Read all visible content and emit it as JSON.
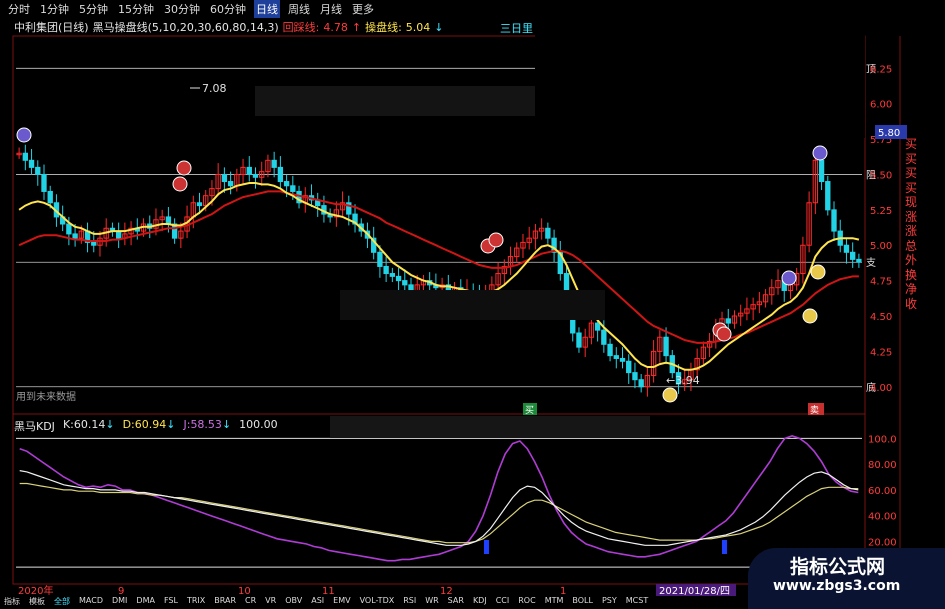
{
  "toolbar": {
    "timeframes": [
      "分时",
      "1分钟",
      "5分钟",
      "15分钟",
      "30分钟",
      "60分钟",
      "日线",
      "周线",
      "月线",
      "更多"
    ],
    "active": "日线"
  },
  "title": {
    "stock": "中利集团(日线)",
    "indicator": "黑马操盘线(5,10,20,30,60,80,14,3)",
    "line1_label": "回踩线:",
    "line1_value": "4.78",
    "line1_arrow": "↑",
    "line2_label": "操盘线:",
    "line2_value": "5.04",
    "line2_arrow": "↓",
    "right_label": "三日里"
  },
  "price_axis": {
    "ticks": [
      "6.25",
      "6.00",
      "5.75",
      "5.50",
      "5.25",
      "5.00",
      "4.75",
      "4.50",
      "4.25",
      "4.00"
    ],
    "current": "5.80"
  },
  "zone_labels": {
    "top": "顶",
    "resist": "阻",
    "support": "支",
    "bottom": "底"
  },
  "annotations": {
    "high": "7.08",
    "low": "3.94",
    "future_note": "用到未来数据",
    "buy_marker": "买",
    "sell_marker": "卖"
  },
  "side_list": [
    "买",
    "买",
    "买",
    "买",
    "现",
    "涨",
    "涨",
    "总",
    "外",
    "换",
    "净",
    "收"
  ],
  "kdj": {
    "name": "黑马KDJ",
    "k_label": "K:",
    "k_value": "60.14",
    "k_arrow": "↓",
    "d_label": "D:",
    "d_value": "60.94",
    "d_arrow": "↓",
    "j_label": "J:",
    "j_value": "58.53",
    "j_arrow": "↓",
    "extra": "100.00"
  },
  "kdj_axis": {
    "ticks": [
      "100.0",
      "80.00",
      "60.00",
      "40.00",
      "20.00"
    ]
  },
  "date_axis": {
    "labels": [
      "2020年",
      "9",
      "10",
      "11",
      "12",
      "1"
    ],
    "cursor": "2021/01/28/四"
  },
  "bottom_tabs": [
    "指标",
    "模板",
    "全部",
    "MACD",
    "DMI",
    "DMA",
    "FSL",
    "TRIX",
    "BRAR",
    "CR",
    "VR",
    "OBV",
    "ASI",
    "EMV",
    "VOL-TDX",
    "RSI",
    "WR",
    "SAR",
    "KDJ",
    "CCI",
    "ROC",
    "MTM",
    "BOLL",
    "PSY",
    "MCST"
  ],
  "bottom_active": "全部",
  "watermark": {
    "line1": "指标公式网",
    "line2": "www.zbgs3.com"
  },
  "colors": {
    "up": "#ff2a2a",
    "down": "#22d3e6",
    "ma_yellow": "#ffe44d",
    "ma_red": "#d01515",
    "k_line": "#f0f0f0",
    "d_line": "#d8d27a",
    "j_line": "#b03cd6",
    "grid": "#c8c8c8"
  },
  "chart_data": {
    "type": "candlestick",
    "title": "中利集团(日线)",
    "ylim": [
      3.85,
      6.45
    ],
    "high_value": 7.08,
    "low_value": 3.94,
    "current_price": 5.8,
    "zones": {
      "top": 6.25,
      "resist": 5.5,
      "support": 4.88,
      "bottom": 4.0
    },
    "closes": [
      5.65,
      5.6,
      5.55,
      5.5,
      5.38,
      5.3,
      5.2,
      5.15,
      5.08,
      5.05,
      5.1,
      5.02,
      5.0,
      5.05,
      5.12,
      5.1,
      5.05,
      5.08,
      5.12,
      5.1,
      5.15,
      5.12,
      5.18,
      5.2,
      5.15,
      5.05,
      5.1,
      5.2,
      5.3,
      5.28,
      5.35,
      5.4,
      5.5,
      5.45,
      5.42,
      5.5,
      5.55,
      5.5,
      5.48,
      5.52,
      5.6,
      5.55,
      5.45,
      5.42,
      5.38,
      5.3,
      5.35,
      5.32,
      5.28,
      5.22,
      5.2,
      5.25,
      5.3,
      5.22,
      5.15,
      5.1,
      5.05,
      4.95,
      4.85,
      4.8,
      4.78,
      4.75,
      4.72,
      4.68,
      4.72,
      4.75,
      4.72,
      4.7,
      4.72,
      4.68,
      4.7,
      4.65,
      4.68,
      4.65,
      4.62,
      4.68,
      4.72,
      4.8,
      4.85,
      4.92,
      4.98,
      5.02,
      5.05,
      5.1,
      5.12,
      5.05,
      4.95,
      4.8,
      4.6,
      4.38,
      4.28,
      4.35,
      4.45,
      4.4,
      4.3,
      4.22,
      4.2,
      4.18,
      4.1,
      4.05,
      4.0,
      4.08,
      4.25,
      4.35,
      4.22,
      4.1,
      4.02,
      4.05,
      4.12,
      4.2,
      4.28,
      4.32,
      4.4,
      4.48,
      4.45,
      4.5,
      4.52,
      4.55,
      4.58,
      4.6,
      4.65,
      4.7,
      4.75,
      4.68,
      4.72,
      4.8,
      5.0,
      5.3,
      5.6,
      5.45,
      5.25,
      5.1,
      5.0,
      4.95,
      4.9,
      4.88
    ],
    "ma_yellow": [
      5.25,
      5.28,
      5.3,
      5.31,
      5.3,
      5.28,
      5.24,
      5.2,
      5.16,
      5.13,
      5.12,
      5.1,
      5.08,
      5.08,
      5.09,
      5.1,
      5.1,
      5.1,
      5.11,
      5.12,
      5.13,
      5.13,
      5.14,
      5.15,
      5.15,
      5.14,
      5.14,
      5.16,
      5.2,
      5.23,
      5.27,
      5.31,
      5.36,
      5.39,
      5.4,
      5.42,
      5.43,
      5.44,
      5.44,
      5.43,
      5.43,
      5.42,
      5.4,
      5.37,
      5.35,
      5.32,
      5.3,
      5.28,
      5.26,
      5.24,
      5.22,
      5.21,
      5.2,
      5.18,
      5.16,
      5.12,
      5.08,
      5.03,
      4.98,
      4.93,
      4.88,
      4.85,
      4.82,
      4.79,
      4.77,
      4.75,
      4.74,
      4.72,
      4.71,
      4.71,
      4.7,
      4.69,
      4.68,
      4.67,
      4.66,
      4.66,
      4.67,
      4.69,
      4.72,
      4.76,
      4.8,
      4.85,
      4.9,
      4.95,
      4.99,
      5.0,
      4.98,
      4.94,
      4.86,
      4.76,
      4.66,
      4.58,
      4.52,
      4.47,
      4.42,
      4.38,
      4.34,
      4.3,
      4.25,
      4.2,
      4.16,
      4.14,
      4.14,
      4.16,
      4.17,
      4.16,
      4.14,
      4.12,
      4.12,
      4.13,
      4.15,
      4.18,
      4.22,
      4.26,
      4.3,
      4.33,
      4.36,
      4.39,
      4.42,
      4.45,
      4.48,
      4.51,
      4.55,
      4.58,
      4.6,
      4.64,
      4.7,
      4.8,
      4.92,
      4.98,
      5.02,
      5.04,
      5.05,
      5.05,
      5.05,
      5.04
    ],
    "ma_red": [
      5.0,
      5.02,
      5.04,
      5.06,
      5.07,
      5.07,
      5.07,
      5.06,
      5.05,
      5.04,
      5.04,
      5.03,
      5.03,
      5.03,
      5.03,
      5.04,
      5.04,
      5.05,
      5.06,
      5.07,
      5.08,
      5.09,
      5.1,
      5.11,
      5.12,
      5.12,
      5.13,
      5.14,
      5.16,
      5.18,
      5.2,
      5.22,
      5.25,
      5.28,
      5.3,
      5.32,
      5.34,
      5.35,
      5.36,
      5.37,
      5.38,
      5.38,
      5.38,
      5.37,
      5.36,
      5.35,
      5.34,
      5.33,
      5.32,
      5.31,
      5.3,
      5.29,
      5.29,
      5.28,
      5.27,
      5.25,
      5.23,
      5.21,
      5.19,
      5.16,
      5.14,
      5.12,
      5.1,
      5.08,
      5.06,
      5.04,
      5.02,
      5.0,
      4.98,
      4.96,
      4.94,
      4.92,
      4.9,
      4.88,
      4.86,
      4.85,
      4.84,
      4.84,
      4.84,
      4.85,
      4.86,
      4.88,
      4.9,
      4.92,
      4.94,
      4.95,
      4.96,
      4.96,
      4.95,
      4.93,
      4.9,
      4.86,
      4.82,
      4.78,
      4.74,
      4.7,
      4.66,
      4.62,
      4.58,
      4.54,
      4.5,
      4.46,
      4.43,
      4.41,
      4.39,
      4.37,
      4.35,
      4.33,
      4.32,
      4.31,
      4.31,
      4.31,
      4.32,
      4.33,
      4.34,
      4.35,
      4.37,
      4.38,
      4.4,
      4.42,
      4.44,
      4.46,
      4.48,
      4.5,
      4.52,
      4.55,
      4.58,
      4.62,
      4.66,
      4.69,
      4.72,
      4.74,
      4.76,
      4.77,
      4.78,
      4.78
    ],
    "kdj_k": [
      75,
      74,
      72,
      70,
      68,
      66,
      64,
      63,
      62,
      61,
      61,
      60,
      60,
      60,
      59,
      59,
      58,
      58,
      57,
      56,
      55,
      54,
      53,
      52,
      51,
      50,
      49,
      48,
      47,
      46,
      45,
      44,
      43,
      42,
      41,
      40,
      39,
      38,
      37,
      36,
      35,
      34,
      33,
      32,
      31,
      30,
      29,
      28,
      27,
      26,
      25,
      24,
      23,
      22,
      21,
      20,
      19,
      18,
      17,
      17,
      17,
      18,
      20,
      24,
      30,
      38,
      46,
      54,
      60,
      63,
      62,
      58,
      52,
      46,
      40,
      35,
      31,
      28,
      26,
      24,
      22,
      21,
      20,
      19,
      18,
      17,
      17,
      17,
      17,
      18,
      19,
      20,
      21,
      22,
      23,
      24,
      25,
      27,
      29,
      32,
      35,
      39,
      44,
      50,
      56,
      61,
      66,
      70,
      73,
      74,
      72,
      68,
      64,
      61,
      60
    ],
    "kdj_d": [
      65,
      65,
      64,
      63,
      62,
      61,
      60,
      60,
      59,
      59,
      59,
      58,
      58,
      58,
      58,
      58,
      57,
      57,
      56,
      56,
      55,
      54,
      54,
      53,
      52,
      51,
      50,
      49,
      48,
      47,
      46,
      45,
      44,
      43,
      42,
      41,
      40,
      39,
      38,
      37,
      36,
      35,
      34,
      33,
      32,
      31,
      30,
      29,
      28,
      27,
      26,
      25,
      24,
      23,
      22,
      21,
      20,
      20,
      19,
      19,
      19,
      19,
      20,
      22,
      26,
      31,
      36,
      41,
      46,
      50,
      52,
      52,
      50,
      47,
      44,
      41,
      38,
      35,
      33,
      31,
      29,
      27,
      26,
      25,
      24,
      23,
      22,
      21,
      21,
      21,
      21,
      21,
      21,
      22,
      22,
      23,
      24,
      25,
      26,
      28,
      30,
      32,
      35,
      39,
      43,
      47,
      51,
      55,
      58,
      61,
      62,
      62,
      62,
      61,
      61
    ],
    "kdj_j": [
      92,
      90,
      86,
      82,
      78,
      74,
      70,
      67,
      64,
      62,
      63,
      62,
      64,
      63,
      60,
      60,
      58,
      57,
      56,
      54,
      52,
      50,
      48,
      46,
      44,
      42,
      40,
      38,
      36,
      34,
      32,
      30,
      28,
      26,
      24,
      22,
      21,
      20,
      19,
      18,
      16,
      15,
      13,
      12,
      11,
      10,
      9,
      8,
      7,
      6,
      5,
      5,
      6,
      6,
      7,
      8,
      9,
      10,
      12,
      14,
      16,
      20,
      28,
      40,
      56,
      74,
      88,
      96,
      98,
      92,
      82,
      70,
      56,
      44,
      34,
      27,
      22,
      18,
      16,
      14,
      12,
      11,
      10,
      9,
      8,
      8,
      9,
      10,
      12,
      14,
      16,
      18,
      20,
      24,
      28,
      32,
      36,
      42,
      50,
      58,
      66,
      74,
      82,
      92,
      100,
      102,
      100,
      96,
      90,
      82,
      72,
      66,
      62,
      59,
      58
    ]
  }
}
